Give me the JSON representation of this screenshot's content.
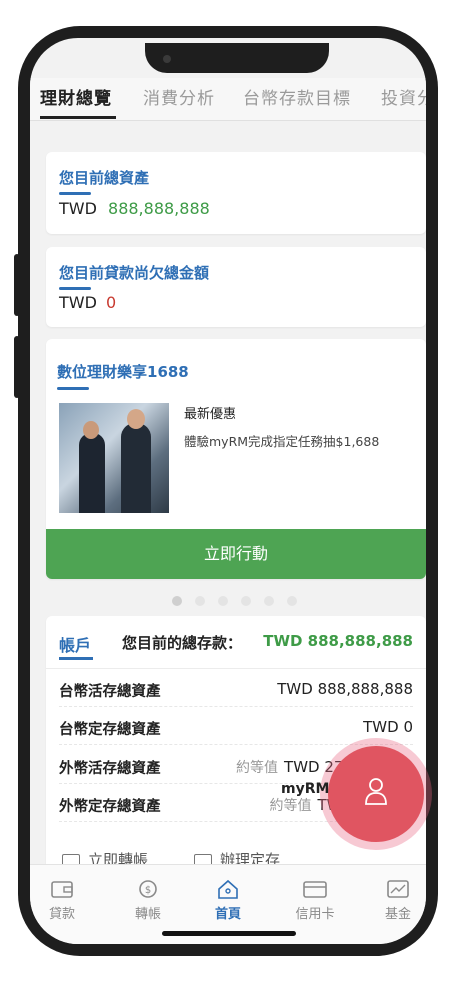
{
  "tabs": [
    {
      "label": "理財總覽",
      "active": true
    },
    {
      "label": "消費分析",
      "active": false
    },
    {
      "label": "台幣存款目標",
      "active": false
    },
    {
      "label": "投資分析",
      "active": false
    }
  ],
  "total_assets": {
    "title": "您目前總資產",
    "currency": "TWD",
    "amount": "888,888,888"
  },
  "loan": {
    "title": "您目前貸款尚欠總金額",
    "currency": "TWD",
    "amount": "0"
  },
  "promo": {
    "title": "數位理財樂享1688",
    "headline": "最新優惠",
    "description": "體驗myRM完成指定任務抽$1,688",
    "button_label": "立即行動",
    "carousel_count": 6,
    "carousel_active_index": 0
  },
  "account": {
    "tab_label": "帳戶",
    "total_label": "您目前的總存款：",
    "total_value": "TWD 888,888,888",
    "rows": [
      {
        "label": "台幣活存總資產",
        "approx": "",
        "value": "TWD 888,888,888"
      },
      {
        "label": "台幣定存總資產",
        "approx": "",
        "value": "TWD 0"
      },
      {
        "label": "外幣活存總資產",
        "approx": "約等值",
        "value": "TWD 271"
      },
      {
        "label": "外幣定存總資產",
        "approx": "約等值",
        "value": "TWD"
      }
    ]
  },
  "quick_actions": [
    {
      "label": "立即轉帳",
      "icon": "transfer-icon"
    },
    {
      "label": "辦理定存",
      "icon": "deposit-icon"
    }
  ],
  "fab": {
    "label": "myRM",
    "icon": "person-icon",
    "color": "#e05561"
  },
  "bottom_nav": [
    {
      "label": "貸款",
      "icon": "wallet-icon",
      "active": false
    },
    {
      "label": "轉帳",
      "icon": "transfer-dollar-icon",
      "active": false
    },
    {
      "label": "首頁",
      "icon": "home-icon",
      "active": true
    },
    {
      "label": "信用卡",
      "icon": "credit-card-icon",
      "active": false
    },
    {
      "label": "基金",
      "icon": "chart-icon",
      "active": false
    }
  ],
  "colors": {
    "accent_blue": "#2f6fb5",
    "green": "#3e9b47",
    "red": "#c83a30",
    "button_green": "#4ea453"
  }
}
